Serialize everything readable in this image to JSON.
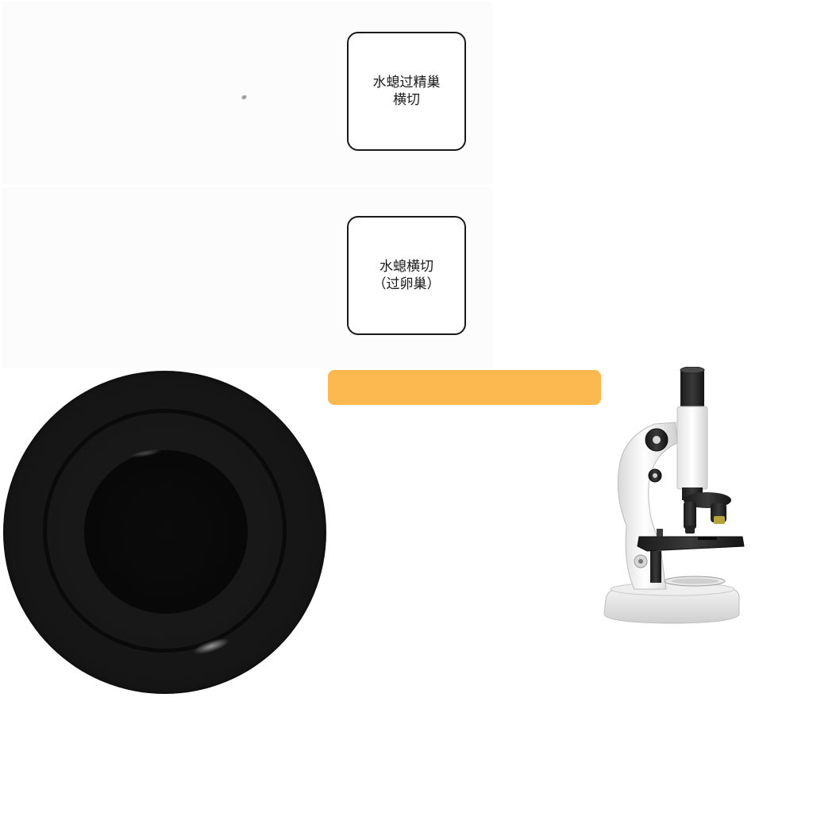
{
  "slides": [
    {
      "label_lines": [
        "水螅过精巢",
        "横切"
      ]
    },
    {
      "label_lines": [
        "水螅横切",
        "（过卵巢）"
      ]
    }
  ],
  "colors": {
    "accent_bar": "#fbb950",
    "card_border": "#1a1a1a",
    "eyepiece": "#161616"
  },
  "icons": {
    "eyepiece": "eyepiece-lens-image",
    "microscope": "microscope-image"
  }
}
